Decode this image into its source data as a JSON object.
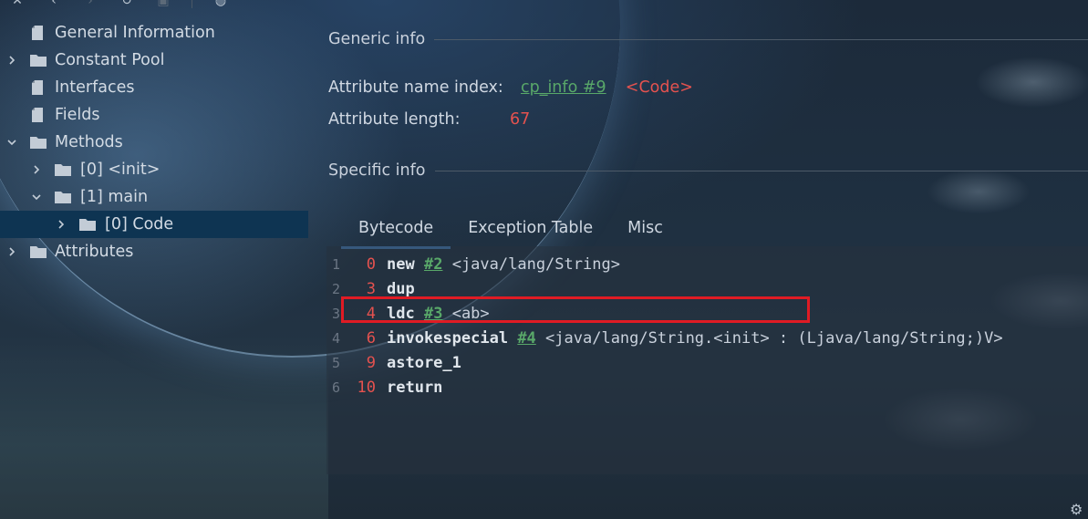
{
  "toolbar": {
    "icons": [
      "close-icon",
      "back-icon",
      "forward-icon",
      "refresh-icon",
      "save-icon",
      "globe-icon"
    ]
  },
  "tree": {
    "items": [
      {
        "label": "General Information",
        "type": "file",
        "expandable": false
      },
      {
        "label": "Constant Pool",
        "type": "folder",
        "expandable": true,
        "expanded": false
      },
      {
        "label": "Interfaces",
        "type": "file",
        "expandable": false
      },
      {
        "label": "Fields",
        "type": "file",
        "expandable": false
      },
      {
        "label": "Methods",
        "type": "folder",
        "expandable": true,
        "expanded": true
      },
      {
        "label": "[0] <init>",
        "type": "folder",
        "expandable": true,
        "expanded": false
      },
      {
        "label": "[1] main",
        "type": "folder",
        "expandable": true,
        "expanded": true
      },
      {
        "label": "[0] Code",
        "type": "folder",
        "expandable": true,
        "expanded": false,
        "selected": true
      },
      {
        "label": "Attributes",
        "type": "folder",
        "expandable": true,
        "expanded": false
      }
    ]
  },
  "generic_info": {
    "heading": "Generic info",
    "name_index_label": "Attribute name index:",
    "name_index_link": "cp_info #9",
    "name_index_value": "<Code>",
    "length_label": "Attribute length:",
    "length_value": "67"
  },
  "specific_info": {
    "heading": "Specific info"
  },
  "tabs": [
    "Bytecode",
    "Exception Table",
    "Misc"
  ],
  "active_tab": "Bytecode",
  "bytecode": [
    {
      "line": "1",
      "offset": "0",
      "op": "new",
      "arg": "#2",
      "comment": "<java/lang/String>"
    },
    {
      "line": "2",
      "offset": "3",
      "op": "dup",
      "arg": "",
      "comment": ""
    },
    {
      "line": "3",
      "offset": "4",
      "op": "ldc",
      "arg": "#3",
      "comment": "<ab>"
    },
    {
      "line": "4",
      "offset": "6",
      "op": "invokespecial",
      "arg": "#4",
      "comment": "<java/lang/String.<init> : (Ljava/lang/String;)V>"
    },
    {
      "line": "5",
      "offset": "9",
      "op": "astore_1",
      "arg": "",
      "comment": ""
    },
    {
      "line": "6",
      "offset": "10",
      "op": "return",
      "arg": "",
      "comment": ""
    }
  ],
  "highlighted_line": "3",
  "colors": {
    "link": "#59a869",
    "offset": "#e5524f",
    "highlight_border": "#e01b24",
    "selection": "#0e3452",
    "tab_underline": "#4a88c7"
  }
}
